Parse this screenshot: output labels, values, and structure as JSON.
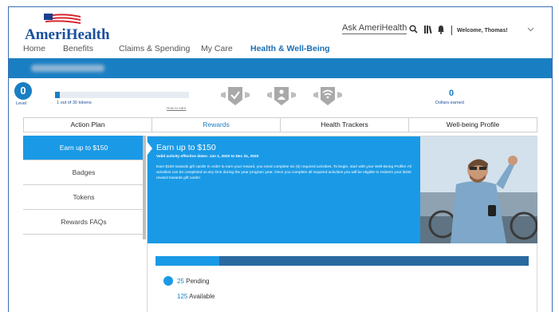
{
  "brand": {
    "name": "AmeriHealth",
    "color": "#1a4f9c"
  },
  "nav": {
    "items": [
      "Home",
      "Benefits",
      "Claims & Spending",
      "My Care",
      "Health & Well-Being"
    ],
    "active_index": 4
  },
  "header": {
    "ask": "Ask AmeriHealth",
    "welcome": "Welcome, Thomas!",
    "icons": [
      "search-icon",
      "library-icon",
      "bell-icon",
      "chevron-down-icon"
    ]
  },
  "progress": {
    "level_value": "0",
    "level_label": "Level",
    "tokens_text": "1 out of 30 tokens",
    "tokens_fraction": 0.033,
    "how_to": "How to earn",
    "dollars_value": "0",
    "dollars_label": "Dollars earned"
  },
  "tabs": [
    "Action Plan",
    "Rewards",
    "Health Trackers",
    "Well-being Profile"
  ],
  "active_tab": 1,
  "sidebar": {
    "items": [
      "Earn up to $150",
      "Badges",
      "Tokens",
      "Rewards FAQs"
    ],
    "active_index": 0
  },
  "promo": {
    "title": "Earn up to $150",
    "dates": "Valid activity effective dates: Jan 1, 2020 to Dec 31, 2020",
    "body": "Earn $150 towards gift cards! In order to earn your reward, you need complete six (6) required activities. To begin, start with your Well-Being Profile! All activities can be completed at any time during the year program year. Once you complete all required activities you will be eligible to redeem your $150 reward towards gift cards!"
  },
  "reward_status": {
    "pending_value": "25",
    "pending_label": "Pending",
    "available_value": "125",
    "available_label": "Available",
    "pending_fraction": 0.17
  },
  "colors": {
    "accent": "#1a9ae6",
    "band": "#1a7fc2",
    "dark_bar": "#2a6aa0"
  }
}
